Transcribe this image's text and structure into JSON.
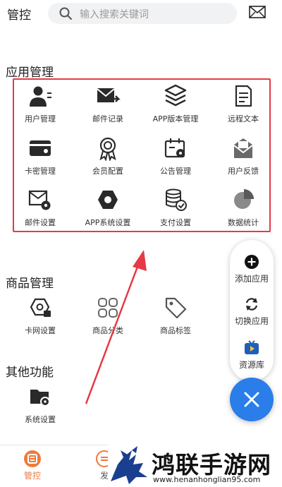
{
  "header": {
    "title": "管控",
    "search_placeholder": "输入搜索关键词"
  },
  "sections": {
    "app_manage": "应用管理",
    "goods_manage": "商品管理",
    "other": "其他功能"
  },
  "app_items": [
    {
      "label": "用户管理",
      "icon": "user-icon"
    },
    {
      "label": "邮件记录",
      "icon": "mail-send-icon"
    },
    {
      "label": "APP版本管理",
      "icon": "layers-icon"
    },
    {
      "label": "远程文本",
      "icon": "document-icon"
    },
    {
      "label": "卡密管理",
      "icon": "card-icon"
    },
    {
      "label": "会员配置",
      "icon": "medal-icon"
    },
    {
      "label": "公告管理",
      "icon": "announcement-icon"
    },
    {
      "label": "用户反馈",
      "icon": "feedback-icon"
    },
    {
      "label": "邮件设置",
      "icon": "mail-settings-icon"
    },
    {
      "label": "APP系统设置",
      "icon": "hexagon-icon"
    },
    {
      "label": "支付设置",
      "icon": "database-check-icon"
    },
    {
      "label": "数据统计",
      "icon": "pie-chart-icon"
    }
  ],
  "goods_items": [
    {
      "label": "卡网设置",
      "icon": "hexagon-card-icon"
    },
    {
      "label": "商品分类",
      "icon": "grid-icon"
    },
    {
      "label": "商品标签",
      "icon": "tag-icon"
    }
  ],
  "other_items": [
    {
      "label": "系统设置",
      "icon": "folder-settings-icon"
    }
  ],
  "fab_menu": [
    {
      "label": "添加应用",
      "icon": "add-circle-icon"
    },
    {
      "label": "切换应用",
      "icon": "switch-icon"
    },
    {
      "label": "资源库",
      "icon": "tv-icon"
    }
  ],
  "bottom_nav": [
    {
      "label": "管控",
      "active": true
    },
    {
      "label": "发",
      "active": false
    }
  ],
  "watermark": {
    "text": "鸿联手游网",
    "url": "www.henanhonglian95.com"
  },
  "colors": {
    "accent": "#2b7de9",
    "highlight": "#e63946",
    "nav_active": "#f07a3b"
  }
}
